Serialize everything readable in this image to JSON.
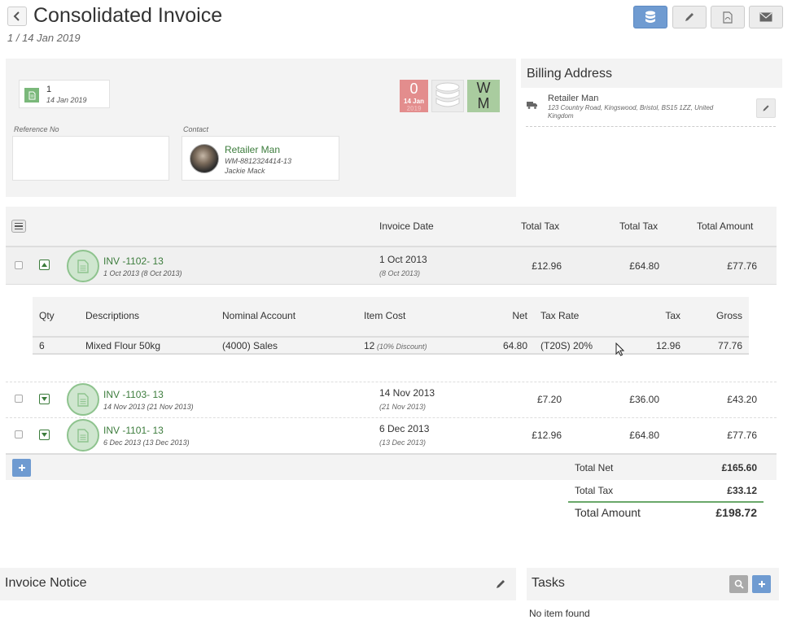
{
  "header": {
    "title": "Consolidated Invoice",
    "subtitle": "1 / 14 Jan 2019"
  },
  "toolbar": {
    "buttons": [
      {
        "icon": "database-icon",
        "active": true
      },
      {
        "icon": "pencil-icon",
        "active": false
      },
      {
        "icon": "pdf-icon",
        "active": false
      },
      {
        "icon": "envelope-icon",
        "active": false
      }
    ]
  },
  "invoice_info": {
    "number": "1",
    "date": "14 Jan 2019",
    "status_count": "0",
    "status_date": "14 Jan",
    "status_year": "2019",
    "owner_initials_top": "W",
    "owner_initials_bottom": "M",
    "reference_label": "Reference No",
    "reference_value": "",
    "contact_label": "Contact",
    "contact": {
      "name": "Retailer Man",
      "code": "WM-8812324414-13",
      "person": "Jackie Mack"
    }
  },
  "billing": {
    "title": "Billing Address",
    "name": "Retailer Man",
    "address": "123 Country Road, Kingswood, Bristol, BS15 1ZZ, United Kingdom"
  },
  "table": {
    "headers": {
      "invoice_date": "Invoice Date",
      "total_tax_1": "Total Tax",
      "total_tax_2": "Total Tax",
      "total_amount": "Total Amount"
    },
    "rows": [
      {
        "id": "INV -1102- 13",
        "sub": "1 Oct 2013 (8 Oct 2013)",
        "date": "1 Oct 2013",
        "due": "(8 Oct 2013)",
        "tax": "£12.96",
        "net": "£64.80",
        "amount": "£77.76",
        "expanded": true
      },
      {
        "id": "INV -1103- 13",
        "sub": "14 Nov 2013 (21 Nov 2013)",
        "date": "14 Nov 2013",
        "due": "(21 Nov 2013)",
        "tax": "£7.20",
        "net": "£36.00",
        "amount": "£43.20",
        "expanded": false
      },
      {
        "id": "INV -1101- 13",
        "sub": "6 Dec 2013 (13 Dec 2013)",
        "date": "6 Dec 2013",
        "due": "(13 Dec 2013)",
        "tax": "£12.96",
        "net": "£64.80",
        "amount": "£77.76",
        "expanded": false
      }
    ],
    "detail": {
      "headers": {
        "qty": "Qty",
        "descriptions": "Descriptions",
        "nominal": "Nominal Account",
        "item_cost": "Item Cost",
        "net": "Net",
        "tax_rate": "Tax Rate",
        "tax": "Tax",
        "gross": "Gross"
      },
      "line": {
        "qty": "6",
        "description": "Mixed Flour 50kg",
        "nominal": "(4000) Sales",
        "item_cost": "12",
        "discount": "(10% Discount)",
        "net": "64.80",
        "tax_rate": "(T20S) 20%",
        "tax": "12.96",
        "gross": "77.76"
      }
    }
  },
  "totals": {
    "net_label": "Total Net",
    "net_value": "£165.60",
    "tax_label": "Total Tax",
    "tax_value": "£33.12",
    "amount_label": "Total Amount",
    "amount_value": "£198.72"
  },
  "notice": {
    "title": "Invoice Notice"
  },
  "tasks": {
    "title": "Tasks",
    "empty": "No item found"
  },
  "colors": {
    "accent_blue": "#6f9bd1",
    "link_green": "#3c7c3c",
    "status_red": "#e38d8d",
    "owner_green": "#a9cc9f"
  }
}
